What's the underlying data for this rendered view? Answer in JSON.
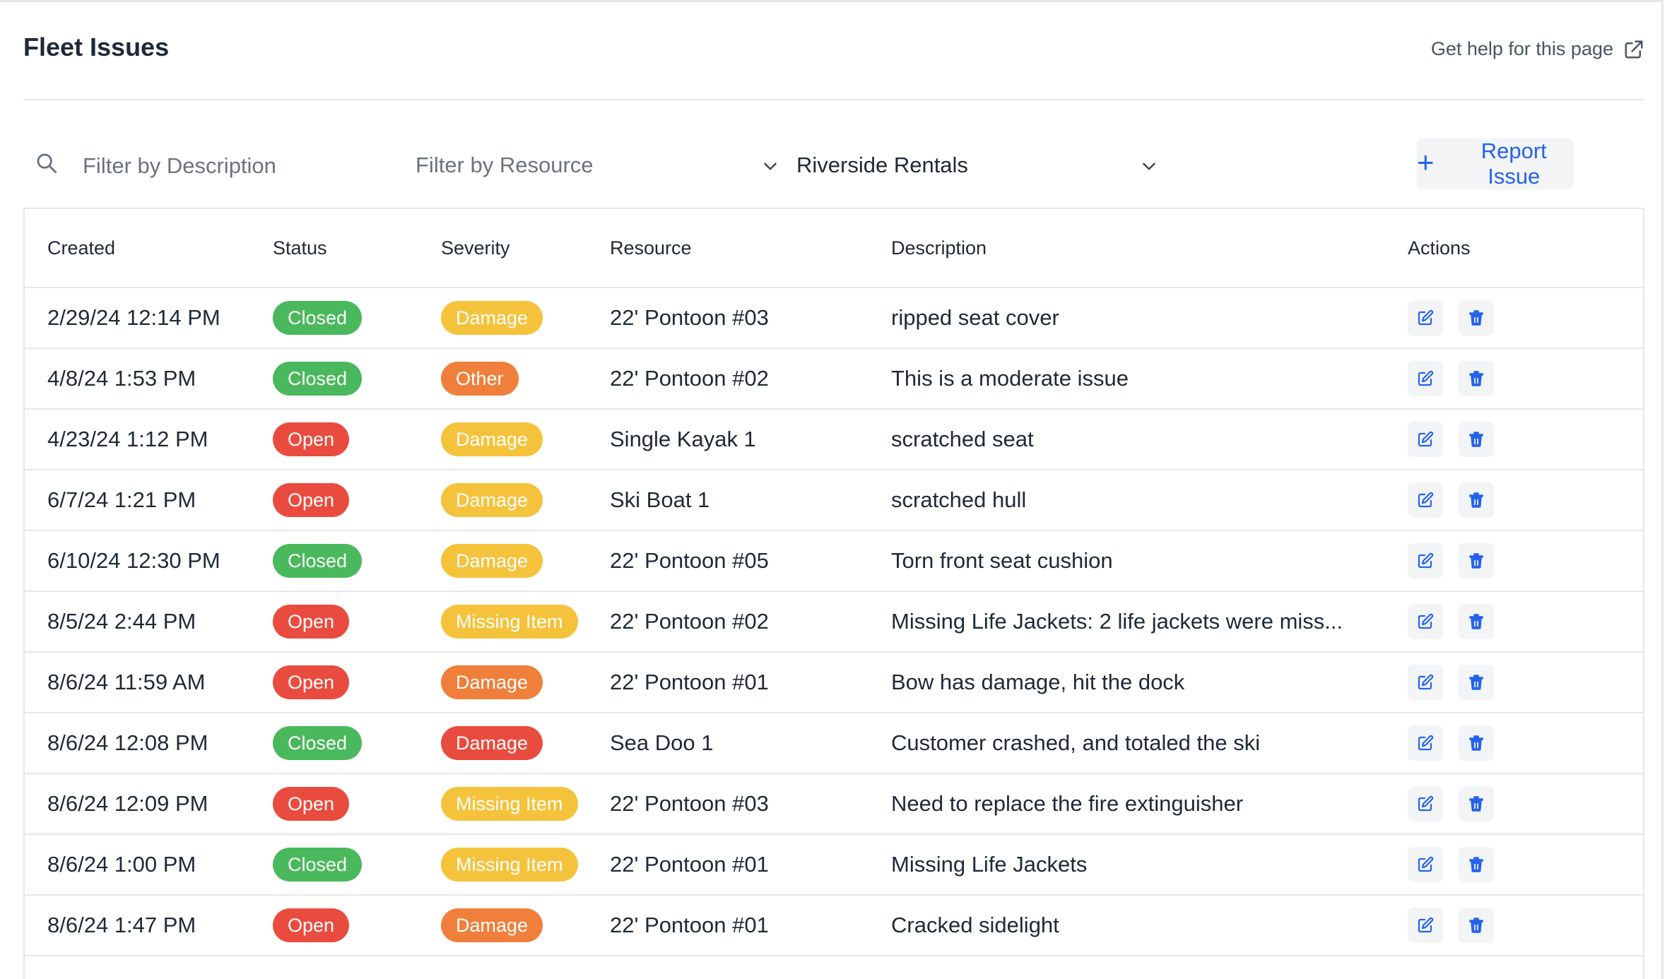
{
  "header": {
    "title": "Fleet Issues",
    "help_label": "Get help for this page"
  },
  "filters": {
    "description_placeholder": "Filter by Description",
    "resource_placeholder": "Filter by Resource",
    "location_value": "Riverside Rentals",
    "report_label": "Report Issue"
  },
  "table": {
    "columns": [
      "Created",
      "Status",
      "Severity",
      "Resource",
      "Description",
      "Actions"
    ],
    "rows": [
      {
        "created": "2/29/24 12:14 PM",
        "status": "Closed",
        "severity": "Damage",
        "resource": "22' Pontoon #03",
        "description": "ripped seat cover"
      },
      {
        "created": "4/8/24 1:53 PM",
        "status": "Closed",
        "severity": "Other",
        "resource": "22' Pontoon #02",
        "description": "This is a moderate issue"
      },
      {
        "created": "4/23/24 1:12 PM",
        "status": "Open",
        "severity": "Damage",
        "resource": "Single Kayak 1",
        "description": "scratched seat"
      },
      {
        "created": "6/7/24 1:21 PM",
        "status": "Open",
        "severity": "Damage",
        "resource": "Ski Boat 1",
        "description": "scratched hull"
      },
      {
        "created": "6/10/24 12:30 PM",
        "status": "Closed",
        "severity": "Damage",
        "resource": "22' Pontoon #05",
        "description": "Torn front seat cushion"
      },
      {
        "created": "8/5/24 2:44 PM",
        "status": "Open",
        "severity": "Missing Item",
        "resource": "22' Pontoon #02",
        "description": "Missing Life Jackets: 2 life jackets were miss..."
      },
      {
        "created": "8/6/24 11:59 AM",
        "status": "Open",
        "severity": "Damage",
        "resource": "22' Pontoon #01",
        "description": "Bow has damage, hit the dock"
      },
      {
        "created": "8/6/24 12:08 PM",
        "status": "Closed",
        "severity": "Damage",
        "resource": "Sea Doo 1",
        "description": "Customer crashed, and totaled the ski"
      },
      {
        "created": "8/6/24 12:09 PM",
        "status": "Open",
        "severity": "Missing Item",
        "resource": "22' Pontoon #03",
        "description": "Need to replace the fire extinguisher"
      },
      {
        "created": "8/6/24 1:00 PM",
        "status": "Closed",
        "severity": "Missing Item",
        "resource": "22' Pontoon #01",
        "description": "Missing Life Jackets"
      },
      {
        "created": "8/6/24 1:47 PM",
        "status": "Open",
        "severity": "Damage",
        "resource": "22' Pontoon #01",
        "description": "Cracked sidelight"
      }
    ]
  },
  "icons": {
    "search": "search-icon",
    "external": "external-link-icon",
    "chevron": "chevron-down-icon",
    "plus": "plus-icon",
    "edit": "edit-icon",
    "delete": "trash-icon"
  },
  "colors": {
    "accent": "#2563eb",
    "closed": "#4ab85c",
    "open": "#e94c3f",
    "severity_by_row": [
      "#f5c23b",
      "#ef7f3a",
      "#f5c23b",
      "#f5c23b",
      "#f5c23b",
      "#f5c23b",
      "#ef7f3a",
      "#e94c3f",
      "#f5c23b",
      "#f5c23b",
      "#ef7f3a"
    ]
  }
}
